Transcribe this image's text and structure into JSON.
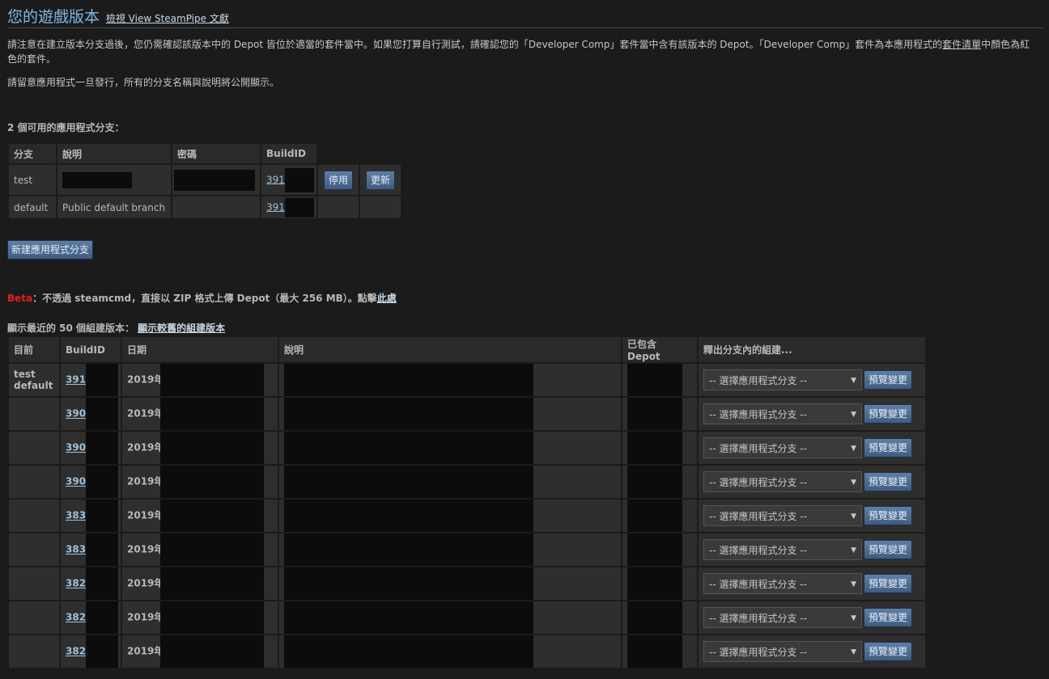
{
  "header": {
    "title": "您的遊戲版本",
    "doc_link": "檢視 View SteamPipe 文獻"
  },
  "intro": {
    "p1_main": "請注意在建立版本分支過後，您仍需確認該版本中的 Depot 皆位於適當的套件當中。如果您打算自行測試，請確認您的「Developer Comp」套件當中含有該版本的 Depot。「Developer Comp」套件為本應用程式的",
    "p1_link": "套件清單",
    "p1_end": "中顏色為紅色的套件。",
    "p2": "請留意應用程式一旦發行，所有的分支名稱與說明將公開顯示。"
  },
  "branches": {
    "heading": "2 個可用的應用程式分支：",
    "columns": [
      "分支",
      "說明",
      "密碼",
      "BuildID"
    ],
    "rows": [
      {
        "name": "test",
        "desc": "",
        "build": "391",
        "disable_label": "停用",
        "update_label": "更新"
      },
      {
        "name": "default",
        "desc": "Public default branch",
        "build": "391"
      }
    ],
    "new_branch_label": "新建應用程式分支"
  },
  "beta": {
    "tag": "Beta",
    "text": "：不透過 steamcmd，直接以 ZIP 格式上傳 Depot（最大 256 MB）。點擊",
    "link": "此處"
  },
  "recent": {
    "heading": "顯示最近的 50 個組建版本：",
    "older_link": "顯示較舊的組建版本",
    "columns": [
      "目前",
      "BuildID",
      "日期",
      "說明",
      "已包含 Depot",
      "釋出分支內的組建..."
    ],
    "select_placeholder": "-- 選擇應用程式分支 --",
    "preview_label": "預覽變更",
    "rows": [
      {
        "current_1": "test",
        "current_2": "default",
        "build": "391",
        "date": "2019年"
      },
      {
        "current_1": "",
        "current_2": "",
        "build": "390",
        "date": "2019年"
      },
      {
        "current_1": "",
        "current_2": "",
        "build": "390",
        "date": "2019年"
      },
      {
        "current_1": "",
        "current_2": "",
        "build": "390",
        "date": "2019年"
      },
      {
        "current_1": "",
        "current_2": "",
        "build": "383",
        "date": "2019年"
      },
      {
        "current_1": "",
        "current_2": "",
        "build": "383",
        "date": "2019年"
      },
      {
        "current_1": "",
        "current_2": "",
        "build": "382",
        "date": "2019年"
      },
      {
        "current_1": "",
        "current_2": "",
        "build": "382",
        "date": "2019年"
      },
      {
        "current_1": "",
        "current_2": "",
        "build": "382",
        "date": "2019年"
      }
    ]
  }
}
